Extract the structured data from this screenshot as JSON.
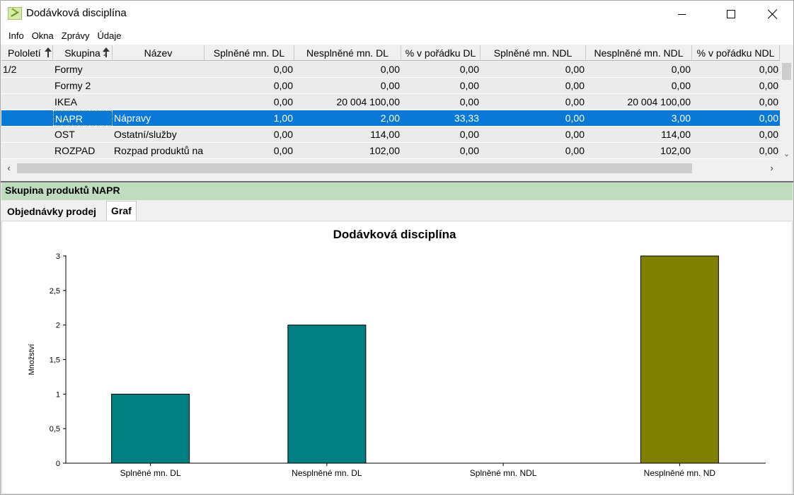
{
  "window": {
    "title": "Dodávková disciplína"
  },
  "menu": [
    "Info",
    "Okna",
    "Zprávy",
    "Údaje"
  ],
  "grid": {
    "columns": [
      "Pololetí",
      "Skupina",
      "Název",
      "Splněné mn. DL",
      "Nesplněné mn. DL",
      "% v pořádku DL",
      "Splněné mn. NDL",
      "Nesplněné mn. NDL",
      "% v pořádku NDL"
    ],
    "sort_indicators": {
      "skupina_order": "2"
    },
    "rows": [
      {
        "pololeti": "1/2",
        "skupina": "Formy",
        "nazev": "",
        "spl_dl": "0,00",
        "nespl_dl": "0,00",
        "pct_dl": "0,00",
        "spl_ndl": "0,00",
        "nespl_ndl": "0,00",
        "pct_ndl": "0,00",
        "selected": false
      },
      {
        "pololeti": "",
        "skupina": "Formy 2",
        "nazev": "",
        "spl_dl": "0,00",
        "nespl_dl": "0,00",
        "pct_dl": "0,00",
        "spl_ndl": "0,00",
        "nespl_ndl": "0,00",
        "pct_ndl": "0,00",
        "selected": false
      },
      {
        "pololeti": "",
        "skupina": "IKEA",
        "nazev": "",
        "spl_dl": "0,00",
        "nespl_dl": "20 004 100,00",
        "pct_dl": "0,00",
        "spl_ndl": "0,00",
        "nespl_ndl": "20 004 100,00",
        "pct_ndl": "0,00",
        "selected": false
      },
      {
        "pololeti": "",
        "skupina": "NAPR",
        "nazev": "Nápravy",
        "spl_dl": "1,00",
        "nespl_dl": "2,00",
        "pct_dl": "33,33",
        "spl_ndl": "0,00",
        "nespl_ndl": "3,00",
        "pct_ndl": "0,00",
        "selected": true
      },
      {
        "pololeti": "",
        "skupina": "OST",
        "nazev": "Ostatní/služby",
        "spl_dl": "0,00",
        "nespl_dl": "114,00",
        "pct_dl": "0,00",
        "spl_ndl": "0,00",
        "nespl_ndl": "114,00",
        "pct_ndl": "0,00",
        "selected": false
      },
      {
        "pololeti": "",
        "skupina": "ROZPAD",
        "nazev": "Rozpad produktů na",
        "spl_dl": "0,00",
        "nespl_dl": "102,00",
        "pct_dl": "0,00",
        "spl_ndl": "0,00",
        "nespl_ndl": "102,00",
        "pct_ndl": "0,00",
        "selected": false
      }
    ]
  },
  "detail": {
    "header": "Skupina produktů NAPR",
    "tabs": [
      "Objednávky prodej",
      "Graf"
    ],
    "active_tab": "Graf"
  },
  "colors": {
    "selection": "#0a78d7",
    "detail_header": "#bfdcbf",
    "bar_dl": "#008080",
    "bar_ndl": "#808000"
  },
  "chart_data": {
    "type": "bar",
    "title": "Dodávková disciplína",
    "ylabel": "Množství",
    "xlabel": "",
    "categories": [
      "Splněné mn. DL",
      "Nesplněné mn. DL",
      "Splněné mn. NDL",
      "Nesplněné mn. ND"
    ],
    "values": [
      1,
      2,
      0,
      3
    ],
    "bar_colors": [
      "#008080",
      "#008080",
      "#808000",
      "#808000"
    ],
    "ylim": [
      0,
      3
    ],
    "yticks": [
      "0",
      "0,5",
      "1",
      "1,5",
      "2",
      "2,5",
      "3"
    ],
    "grid": false,
    "legend": "none"
  }
}
